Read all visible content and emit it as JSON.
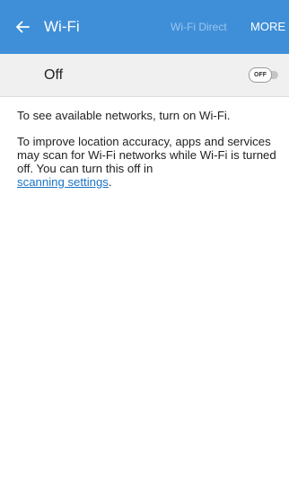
{
  "appbar": {
    "title": "Wi-Fi",
    "back_icon": "arrow-left-icon",
    "wifi_direct_label": "Wi-Fi Direct",
    "more_label": "MORE",
    "background_color": "#3f8fd8",
    "disabled_action_color": "#9cc6ee"
  },
  "switch_row": {
    "label": "Off",
    "toggle_text": "OFF",
    "toggle_state": "off"
  },
  "content": {
    "paragraph1": "To see available networks, turn on Wi-Fi.",
    "paragraph2": "To improve location accuracy, apps and services may scan for Wi-Fi networks while Wi-Fi is turned off. You can turn this off in",
    "link_text": "scanning settings",
    "trailing_punct": ".",
    "link_color": "#1a73c8"
  }
}
